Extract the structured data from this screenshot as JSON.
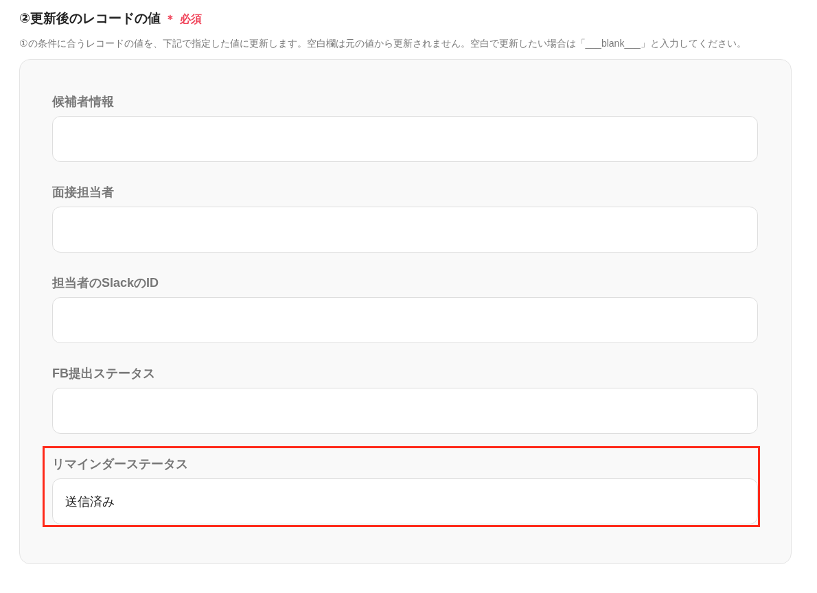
{
  "section": {
    "title": "②更新後のレコードの値",
    "required_mark": "＊",
    "required_label": "必須",
    "description": "①の条件に合うレコードの値を、下記で指定した値に更新します。空白欄は元の値から更新されません。空白で更新したい場合は「___blank___」と入力してください。"
  },
  "fields": [
    {
      "label": "候補者情報",
      "highlighted": false
    },
    {
      "label": "面接担当者",
      "highlighted": false
    },
    {
      "label": "担当者のSlackのID",
      "highlighted": false
    },
    {
      "label": "FB提出ステータス",
      "highlighted": false
    },
    {
      "label": "リマインダーステータス",
      "value": "送信済み",
      "highlighted": true
    }
  ]
}
